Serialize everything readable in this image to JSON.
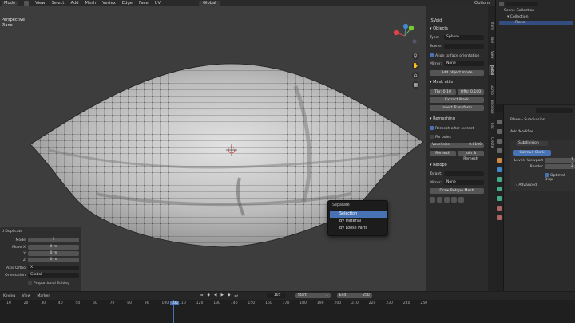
{
  "topbar": {
    "mode": "Mode",
    "menus": [
      "View",
      "Select",
      "Add",
      "Mesh",
      "Vertex",
      "Edge",
      "Face",
      "UV"
    ],
    "orientation": "Global",
    "options": "Options"
  },
  "viewport": {
    "view_label": "Perspective",
    "object_label": "Plane"
  },
  "npanel": {
    "title": "JSVoid",
    "objects_header": "Objects",
    "type_label": "Type:",
    "type_value": "Sphere",
    "scene_label": "Scene:",
    "align_label": "Align to face orientation",
    "mirror_label": "Mirror:",
    "mirror_value": "None",
    "add_object_mode": "Add object mode",
    "mask_utils_header": "Mask utils",
    "thr_label": "Thr: 0.10",
    "offs_label": "Offs: 0.100",
    "extract_mask": "Extract Mask",
    "invert_transform": "Invert Transform",
    "remeshing_header": "Remeshing",
    "remesh_after_extract": "Remesh after extract",
    "fix_poles": "Fix poles",
    "voxel_size_label": "Voxel size",
    "voxel_size_value": "0.0100",
    "remesh_btn": "Remesh",
    "join_remesh_btn": "Join & Remesh",
    "retopo_header": "Retopo",
    "target_label": "Target:",
    "retopo_mirror_label": "Mirror:",
    "retopo_mirror_value": "None",
    "draw_retopo": "Draw Retopo Mesh"
  },
  "ntabs": [
    "Item",
    "Tool",
    "View",
    "JSVoid",
    "Gizmo",
    "BoolTool",
    "Edit",
    "Create"
  ],
  "outliner": {
    "scene_collection": "Scene Collection",
    "collection": "Collection",
    "plane": "Plane"
  },
  "properties": {
    "breadcrumb_object": "Plane",
    "breadcrumb_modifier": "Subdivision",
    "add_modifier": "Add Modifier",
    "modifier_name": "Subdivision",
    "catmull_clark": "Catmull-Clark",
    "levels_viewport_label": "Levels Viewport",
    "levels_viewport_value": "1",
    "render_label": "Render",
    "render_value": "2",
    "optimal_display": "Optimal Displ",
    "advanced": "Advanced"
  },
  "popup": {
    "title": "Separate",
    "items": [
      "Selection",
      "By Material",
      "By Loose Parts"
    ],
    "selected_index": 0
  },
  "redo_panel": {
    "title": "d Duplicate",
    "mode_label": "Mode",
    "mode_value": "1",
    "move_x_label": "Move X",
    "move_x_value": "0 m",
    "y_label": "Y",
    "y_value": "0 m",
    "z_label": "Z",
    "z_value": "0 m",
    "axis_ortho_label": "Axis Ortho",
    "axis_ortho_value": "X",
    "orientation_label": "Orientation",
    "orientation_value": "Global",
    "proportional_editing": "Proportional Editing"
  },
  "timeline": {
    "keying": "Keying",
    "view": "View",
    "marker": "Marker",
    "current_frame": "105",
    "start_label": "Start",
    "start_value": "1",
    "end_label": "End",
    "end_value": "250",
    "ticks": [
      "10",
      "20",
      "30",
      "40",
      "50",
      "60",
      "70",
      "80",
      "90",
      "100",
      "105",
      "110",
      "120",
      "130",
      "140",
      "150",
      "160",
      "170",
      "180",
      "190",
      "200",
      "210",
      "220",
      "230",
      "240",
      "250"
    ]
  },
  "colors": {
    "accent": "#4772b3",
    "viewport_bg": "#3d3d3d",
    "panel_bg": "#2b2b2b",
    "playhead": "#4772b3"
  }
}
